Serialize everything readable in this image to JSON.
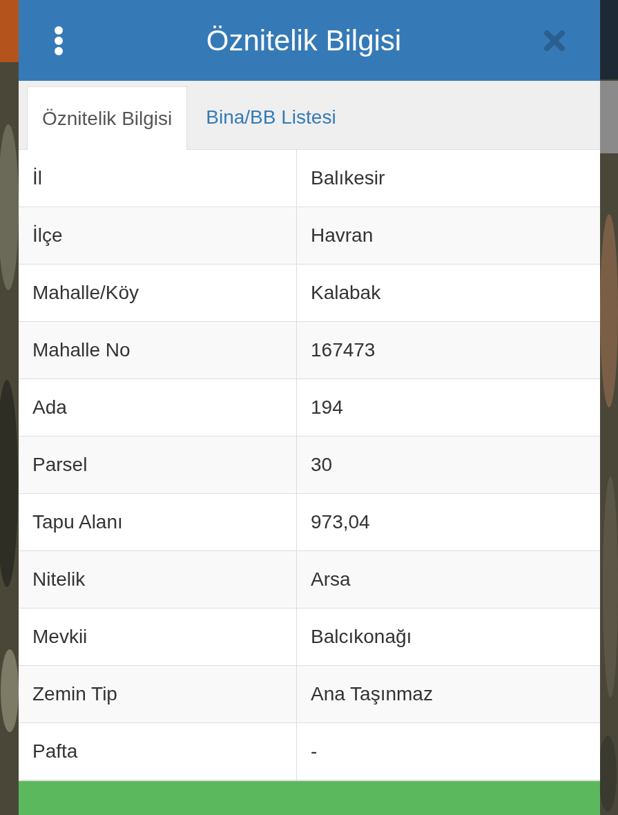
{
  "window": {
    "title": "Öznitelik Bilgisi"
  },
  "tabs": [
    {
      "label": "Öznitelik Bilgisi",
      "selected": true
    },
    {
      "label": "Bina/BB Listesi",
      "selected": false
    }
  ],
  "table": {
    "rows": [
      {
        "label": "İl",
        "value": "Balıkesir"
      },
      {
        "label": "İlçe",
        "value": "Havran"
      },
      {
        "label": "Mahalle/Köy",
        "value": "Kalabak"
      },
      {
        "label": "Mahalle No",
        "value": "167473"
      },
      {
        "label": "Ada",
        "value": "194"
      },
      {
        "label": "Parsel",
        "value": "30"
      },
      {
        "label": "Tapu Alanı",
        "value": "973,04"
      },
      {
        "label": "Nitelik",
        "value": "Arsa"
      },
      {
        "label": "Mevkii",
        "value": "Balcıkonağı"
      },
      {
        "label": "Zemin Tip",
        "value": "Ana Taşınmaz"
      },
      {
        "label": "Pafta",
        "value": "-"
      }
    ]
  }
}
